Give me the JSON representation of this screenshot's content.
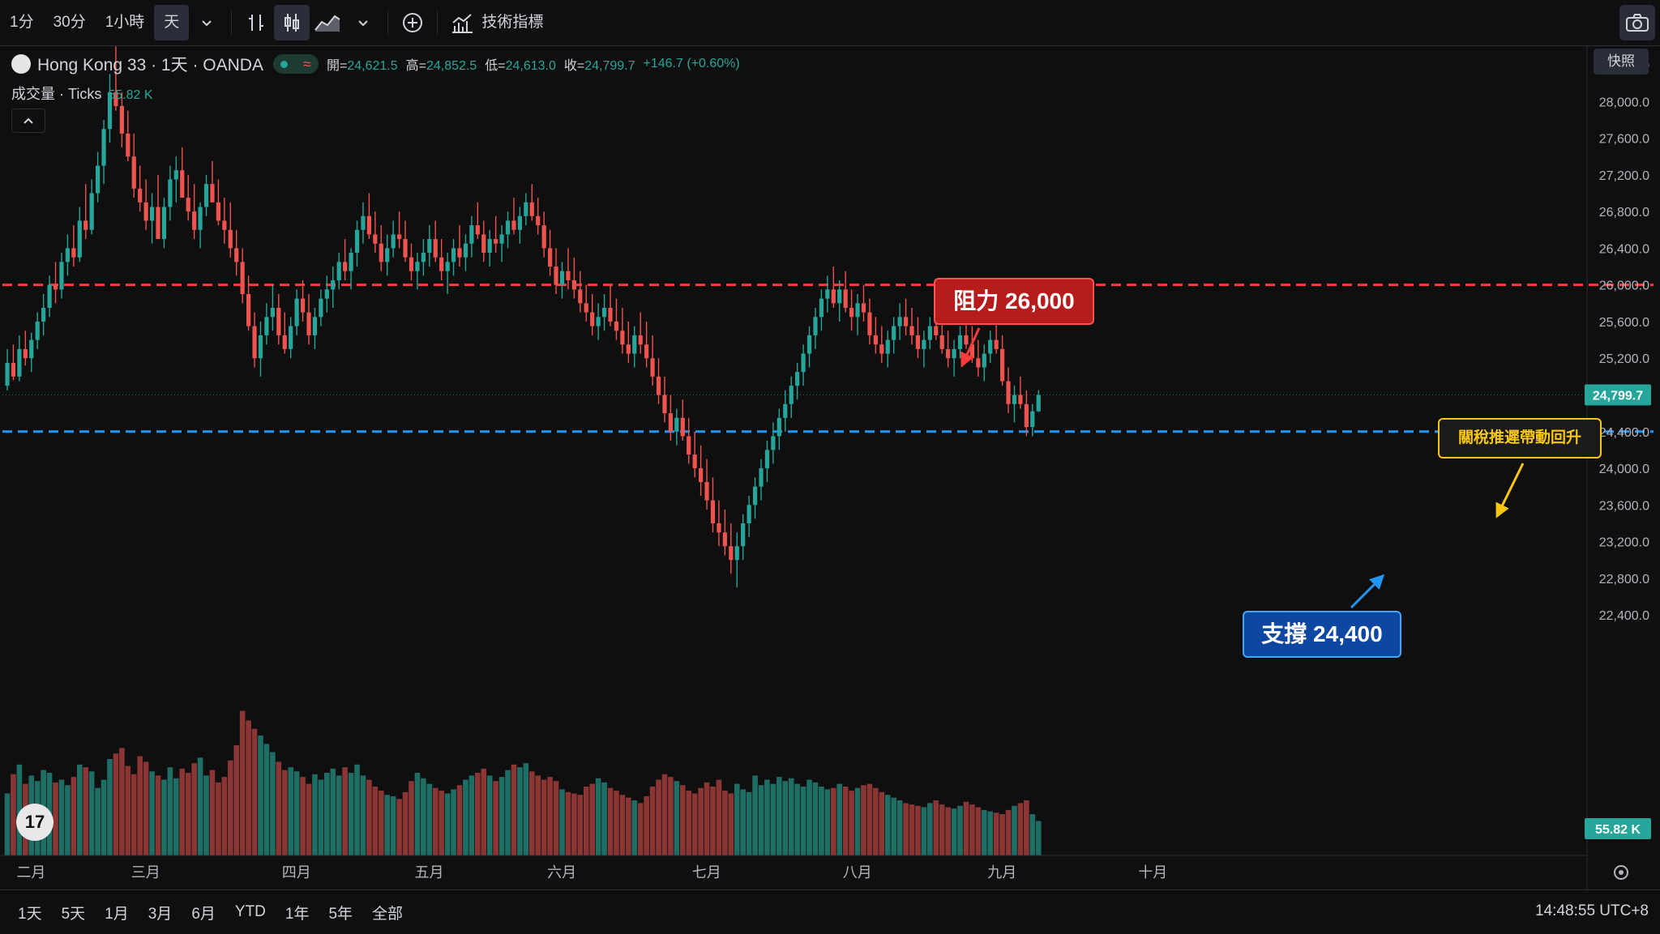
{
  "toolbar": {
    "intervals": [
      "1分",
      "30分",
      "1小時",
      "天"
    ],
    "active_interval": "天",
    "indicators_label": "技術指標"
  },
  "legend": {
    "symbol": "Hong Kong 33 · 1天 · OANDA",
    "open_label": "開=",
    "open": "24,621.5",
    "high_label": "高=",
    "high": "24,852.5",
    "low_label": "低=",
    "low": "24,613.0",
    "close_label": "收=",
    "close": "24,799.7",
    "change": "+146.7 (+0.60%)",
    "volume_title": "成交量 · Ticks",
    "volume_value": "55.82 K"
  },
  "snapshot_label": "快照",
  "annotations": {
    "resistance": "阻力 26,000",
    "support": "支撐 24,400",
    "note": "關稅推遲帶動回升"
  },
  "price_axis": {
    "ticks": [
      "28,400.0",
      "28,000.0",
      "27,600.0",
      "27,200.0",
      "26,800.0",
      "26,400.0",
      "26,000.0",
      "25,600.0",
      "25,200.0",
      "24,400.0",
      "24,000.0",
      "23,600.0",
      "23,200.0",
      "22,800.0",
      "22,400.0"
    ],
    "last_price_label": "24,799.7",
    "volume_label": "55.82 K"
  },
  "time_axis": [
    "二月",
    "三月",
    "四月",
    "五月",
    "六月",
    "七月",
    "八月",
    "九月",
    "十月"
  ],
  "ranges": [
    "1天",
    "5天",
    "1月",
    "3月",
    "6月",
    "YTD",
    "1年",
    "5年",
    "全部"
  ],
  "clock": "14:48:55 UTC+8",
  "logo_text": "17",
  "colors": {
    "up": "#26a69a",
    "down": "#ef5350",
    "resistance": "#ff3b3b",
    "support": "#2196f3",
    "note": "#f9c80e"
  },
  "chart_data": {
    "type": "candlestick",
    "symbol": "Hong Kong 33",
    "interval": "1天",
    "ylim": [
      22200,
      28700
    ],
    "yticks": [
      22400,
      22800,
      23200,
      23600,
      24000,
      24400,
      25200,
      25600,
      26000,
      26400,
      26800,
      27200,
      27600,
      28000,
      28400
    ],
    "month_labels": [
      {
        "label": "二月",
        "index": 1
      },
      {
        "label": "三月",
        "index": 20
      },
      {
        "label": "四月",
        "index": 45
      },
      {
        "label": "五月",
        "index": 67
      },
      {
        "label": "六月",
        "index": 89
      },
      {
        "label": "七月",
        "index": 113
      },
      {
        "label": "八月",
        "index": 138
      },
      {
        "label": "九月",
        "index": 162
      },
      {
        "label": "十月",
        "index": 187
      }
    ],
    "levels": [
      {
        "name": "阻力",
        "value": 26000
      },
      {
        "name": "支撐",
        "value": 24400
      }
    ],
    "last_price": 24799.7,
    "candles": [
      [
        24900,
        25300,
        24850,
        25150,
        45
      ],
      [
        25150,
        25350,
        24960,
        25000,
        59
      ],
      [
        25000,
        25450,
        24950,
        25300,
        66
      ],
      [
        25300,
        25500,
        25120,
        25200,
        52
      ],
      [
        25200,
        25480,
        25050,
        25400,
        58
      ],
      [
        25400,
        25700,
        25300,
        25600,
        54
      ],
      [
        25600,
        25900,
        25450,
        25750,
        62
      ],
      [
        25750,
        26100,
        25650,
        26000,
        60
      ],
      [
        26000,
        26250,
        25800,
        25950,
        53
      ],
      [
        25950,
        26350,
        25850,
        26250,
        55
      ],
      [
        26250,
        26550,
        26100,
        26400,
        51
      ],
      [
        26400,
        26650,
        26200,
        26300,
        57
      ],
      [
        26300,
        26850,
        26250,
        26700,
        66
      ],
      [
        26700,
        27100,
        26500,
        26600,
        64
      ],
      [
        26600,
        27150,
        26550,
        27000,
        61
      ],
      [
        27000,
        27450,
        26900,
        27300,
        49
      ],
      [
        27300,
        27800,
        27100,
        27700,
        55
      ],
      [
        27700,
        28300,
        27550,
        28100,
        70
      ],
      [
        28100,
        28600,
        27900,
        27950,
        74
      ],
      [
        27950,
        28100,
        27500,
        27650,
        78
      ],
      [
        27650,
        27900,
        27350,
        27400,
        65
      ],
      [
        27400,
        27650,
        26950,
        27050,
        59
      ],
      [
        27050,
        27300,
        26800,
        26900,
        72
      ],
      [
        26900,
        27150,
        26600,
        26700,
        68
      ],
      [
        26700,
        27000,
        26450,
        26850,
        61
      ],
      [
        26850,
        27200,
        26650,
        26500,
        58
      ],
      [
        26500,
        26950,
        26400,
        26850,
        55
      ],
      [
        26850,
        27300,
        26700,
        27150,
        64
      ],
      [
        27150,
        27400,
        26900,
        27250,
        56
      ],
      [
        27250,
        27500,
        27000,
        26950,
        63
      ],
      [
        26950,
        27200,
        26700,
        26800,
        60
      ],
      [
        26800,
        27100,
        26500,
        26600,
        67
      ],
      [
        26600,
        26900,
        26400,
        26850,
        71
      ],
      [
        26850,
        27200,
        26750,
        27100,
        58
      ],
      [
        27100,
        27350,
        26900,
        26900,
        62
      ],
      [
        26900,
        27150,
        26650,
        26700,
        53
      ],
      [
        26700,
        26950,
        26450,
        26600,
        57
      ],
      [
        26600,
        26900,
        26300,
        26400,
        69
      ],
      [
        26400,
        26600,
        26100,
        26250,
        80
      ],
      [
        26250,
        26400,
        25800,
        25900,
        105
      ],
      [
        25900,
        26100,
        25500,
        25550,
        98
      ],
      [
        25550,
        25700,
        25100,
        25200,
        92
      ],
      [
        25200,
        25600,
        25000,
        25450,
        87
      ],
      [
        25450,
        25800,
        25350,
        25650,
        81
      ],
      [
        25650,
        26000,
        25500,
        25750,
        75
      ],
      [
        25750,
        25900,
        25350,
        25450,
        68
      ],
      [
        25450,
        25700,
        25250,
        25300,
        62
      ],
      [
        25300,
        25650,
        25200,
        25550,
        64
      ],
      [
        25550,
        25950,
        25450,
        25850,
        61
      ],
      [
        25850,
        26050,
        25600,
        25700,
        57
      ],
      [
        25700,
        25900,
        25350,
        25450,
        52
      ],
      [
        25450,
        25750,
        25300,
        25650,
        59
      ],
      [
        25650,
        25950,
        25550,
        25850,
        55
      ],
      [
        25850,
        26100,
        25700,
        25950,
        60
      ],
      [
        25950,
        26200,
        25750,
        26050,
        63
      ],
      [
        26050,
        26350,
        25950,
        26250,
        58
      ],
      [
        26250,
        26500,
        26050,
        26150,
        64
      ],
      [
        26150,
        26400,
        25950,
        26350,
        60
      ],
      [
        26350,
        26700,
        26200,
        26600,
        66
      ],
      [
        26600,
        26900,
        26450,
        26750,
        58
      ],
      [
        26750,
        27000,
        26500,
        26550,
        55
      ],
      [
        26550,
        26800,
        26350,
        26450,
        50
      ],
      [
        26450,
        26650,
        26150,
        26250,
        47
      ],
      [
        26250,
        26550,
        26100,
        26400,
        44
      ],
      [
        26400,
        26700,
        26300,
        26550,
        43
      ],
      [
        26550,
        26800,
        26400,
        26500,
        41
      ],
      [
        26500,
        26700,
        26250,
        26300,
        46
      ],
      [
        26300,
        26450,
        26050,
        26150,
        54
      ],
      [
        26150,
        26350,
        25950,
        26250,
        60
      ],
      [
        26250,
        26500,
        26100,
        26350,
        56
      ],
      [
        26350,
        26650,
        26200,
        26500,
        52
      ],
      [
        26500,
        26700,
        26250,
        26300,
        49
      ],
      [
        26300,
        26500,
        26050,
        26150,
        47
      ],
      [
        26150,
        26350,
        25900,
        26250,
        45
      ],
      [
        26250,
        26500,
        26100,
        26400,
        48
      ],
      [
        26400,
        26650,
        26200,
        26300,
        51
      ],
      [
        26300,
        26550,
        26150,
        26450,
        55
      ],
      [
        26450,
        26750,
        26300,
        26650,
        58
      ],
      [
        26650,
        26900,
        26500,
        26550,
        60
      ],
      [
        26550,
        26700,
        26250,
        26350,
        63
      ],
      [
        26350,
        26600,
        26200,
        26500,
        58
      ],
      [
        26500,
        26750,
        26350,
        26450,
        54
      ],
      [
        26450,
        26650,
        26250,
        26550,
        57
      ],
      [
        26550,
        26800,
        26400,
        26700,
        62
      ],
      [
        26700,
        26950,
        26550,
        26600,
        66
      ],
      [
        26600,
        26850,
        26450,
        26750,
        64
      ],
      [
        26750,
        27000,
        26650,
        26900,
        67
      ],
      [
        26900,
        27100,
        26700,
        26750,
        61
      ],
      [
        26750,
        26950,
        26550,
        26650,
        58
      ],
      [
        26650,
        26800,
        26300,
        26400,
        55
      ],
      [
        26400,
        26600,
        26100,
        26200,
        57
      ],
      [
        26200,
        26400,
        25900,
        26000,
        54
      ],
      [
        26000,
        26250,
        25850,
        26150,
        48
      ],
      [
        26150,
        26400,
        25950,
        26050,
        46
      ],
      [
        26050,
        26300,
        25850,
        25950,
        45
      ],
      [
        25950,
        26150,
        25700,
        25800,
        44
      ],
      [
        25800,
        26000,
        25600,
        25700,
        50
      ],
      [
        25700,
        25900,
        25450,
        25550,
        52
      ],
      [
        25550,
        25800,
        25400,
        25650,
        56
      ],
      [
        25650,
        25900,
        25500,
        25750,
        53
      ],
      [
        25750,
        26000,
        25550,
        25600,
        49
      ],
      [
        25600,
        25850,
        25400,
        25500,
        47
      ],
      [
        25500,
        25750,
        25250,
        25350,
        44
      ],
      [
        25350,
        25600,
        25150,
        25250,
        42
      ],
      [
        25250,
        25550,
        25100,
        25450,
        40
      ],
      [
        25450,
        25700,
        25250,
        25350,
        38
      ],
      [
        25350,
        25600,
        25100,
        25200,
        43
      ],
      [
        25200,
        25450,
        24900,
        25000,
        50
      ],
      [
        25000,
        25200,
        24700,
        24800,
        55
      ],
      [
        24800,
        25000,
        24500,
        24600,
        59
      ],
      [
        24600,
        24800,
        24300,
        24400,
        57
      ],
      [
        24400,
        24650,
        24250,
        24550,
        54
      ],
      [
        24550,
        24750,
        24300,
        24350,
        51
      ],
      [
        24350,
        24550,
        24050,
        24150,
        47
      ],
      [
        24150,
        24400,
        23900,
        24000,
        45
      ],
      [
        24000,
        24250,
        23700,
        23850,
        49
      ],
      [
        23850,
        24100,
        23550,
        23650,
        53
      ],
      [
        23650,
        23900,
        23300,
        23400,
        50
      ],
      [
        23400,
        23650,
        23150,
        23300,
        55
      ],
      [
        23300,
        23550,
        23050,
        23150,
        47
      ],
      [
        23150,
        23400,
        22850,
        23000,
        45
      ],
      [
        23000,
        23300,
        22700,
        23150,
        52
      ],
      [
        23150,
        23500,
        23000,
        23400,
        48
      ],
      [
        23400,
        23700,
        23250,
        23600,
        46
      ],
      [
        23600,
        23900,
        23450,
        23800,
        58
      ],
      [
        23800,
        24100,
        23650,
        24000,
        51
      ],
      [
        24000,
        24300,
        23850,
        24200,
        55
      ],
      [
        24200,
        24500,
        24050,
        24350,
        52
      ],
      [
        24350,
        24650,
        24200,
        24550,
        57
      ],
      [
        24550,
        24850,
        24400,
        24700,
        54
      ],
      [
        24700,
        25000,
        24550,
        24900,
        56
      ],
      [
        24900,
        25150,
        24750,
        25050,
        52
      ],
      [
        25050,
        25350,
        24900,
        25250,
        50
      ],
      [
        25250,
        25550,
        25100,
        25450,
        55
      ],
      [
        25450,
        25750,
        25300,
        25650,
        53
      ],
      [
        25650,
        25950,
        25500,
        25850,
        50
      ],
      [
        25850,
        26100,
        25700,
        25950,
        48
      ],
      [
        25950,
        26200,
        25750,
        25800,
        49
      ],
      [
        25800,
        26050,
        25600,
        25950,
        52
      ],
      [
        25950,
        26150,
        25700,
        25750,
        50
      ],
      [
        25750,
        25950,
        25500,
        25650,
        47
      ],
      [
        25650,
        25900,
        25450,
        25800,
        49
      ],
      [
        25800,
        26000,
        25600,
        25700,
        51
      ],
      [
        25700,
        25850,
        25350,
        25450,
        52
      ],
      [
        25450,
        25650,
        25250,
        25350,
        49
      ],
      [
        25350,
        25550,
        25150,
        25250,
        46
      ],
      [
        25250,
        25500,
        25100,
        25400,
        44
      ],
      [
        25400,
        25650,
        25250,
        25550,
        42
      ],
      [
        25550,
        25800,
        25400,
        25650,
        40
      ],
      [
        25650,
        25850,
        25450,
        25550,
        38
      ],
      [
        25550,
        25750,
        25350,
        25450,
        37
      ],
      [
        25450,
        25650,
        25200,
        25300,
        36
      ],
      [
        25300,
        25500,
        25100,
        25400,
        35
      ],
      [
        25400,
        25650,
        25300,
        25550,
        38
      ],
      [
        25550,
        25750,
        25400,
        25450,
        40
      ],
      [
        25450,
        25650,
        25250,
        25300,
        37
      ],
      [
        25300,
        25500,
        25100,
        25200,
        35
      ],
      [
        25200,
        25400,
        25000,
        25300,
        34
      ],
      [
        25300,
        25550,
        25200,
        25450,
        36
      ],
      [
        25450,
        25650,
        25300,
        25350,
        39
      ],
      [
        25350,
        25550,
        25150,
        25200,
        37
      ],
      [
        25200,
        25400,
        25000,
        25100,
        35
      ],
      [
        25100,
        25350,
        24950,
        25250,
        33
      ],
      [
        25250,
        25500,
        25150,
        25400,
        32
      ],
      [
        25400,
        25600,
        25250,
        25300,
        31
      ],
      [
        25300,
        25450,
        24900,
        24950,
        30
      ],
      [
        24950,
        25100,
        24600,
        24700,
        33
      ],
      [
        24700,
        24900,
        24500,
        24800,
        36
      ],
      [
        24800,
        25000,
        24650,
        24700,
        38
      ],
      [
        24700,
        24850,
        24350,
        24450,
        40
      ],
      [
        24450,
        24700,
        24350,
        24621.5,
        30
      ],
      [
        24621.5,
        24852.5,
        24613,
        24799.7,
        25
      ]
    ]
  }
}
